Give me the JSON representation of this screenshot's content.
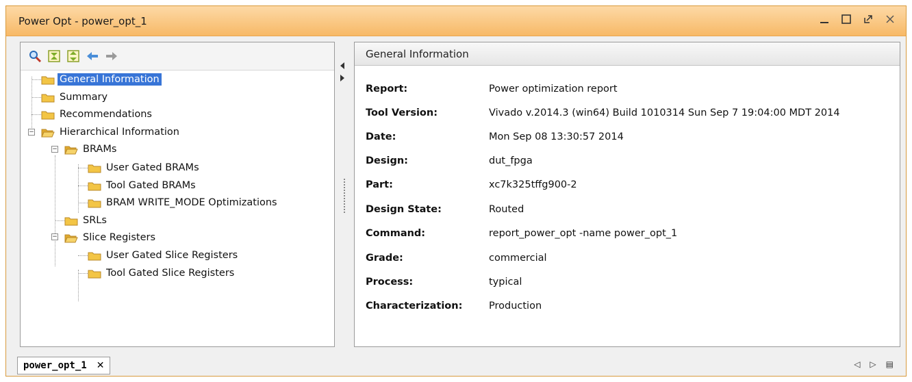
{
  "window": {
    "title": "Power Opt - power_opt_1"
  },
  "tree": {
    "items": [
      {
        "label": "General Information"
      },
      {
        "label": "Summary"
      },
      {
        "label": "Recommendations"
      },
      {
        "label": "Hierarchical Information"
      },
      {
        "label": "BRAMs"
      },
      {
        "label": "User Gated BRAMs"
      },
      {
        "label": "Tool Gated BRAMs"
      },
      {
        "label": "BRAM WRITE_MODE Optimizations"
      },
      {
        "label": "SRLs"
      },
      {
        "label": "Slice Registers"
      },
      {
        "label": "User Gated Slice Registers"
      },
      {
        "label": "Tool Gated Slice Registers"
      }
    ]
  },
  "detail": {
    "header": "General Information",
    "rows": [
      {
        "key": "Report:",
        "value": "Power optimization report"
      },
      {
        "key": "Tool Version:",
        "value": "Vivado v.2014.3 (win64) Build 1010314 Sun Sep 7 19:04:00 MDT 2014"
      },
      {
        "key": "Date:",
        "value": "Mon Sep 08 13:30:57 2014"
      },
      {
        "key": "Design:",
        "value": "dut_fpga"
      },
      {
        "key": "Part:",
        "value": "xc7k325tffg900-2"
      },
      {
        "key": "Design State:",
        "value": "Routed"
      },
      {
        "key": "Command:",
        "value": "report_power_opt -name power_opt_1"
      },
      {
        "key": "Grade:",
        "value": "commercial"
      },
      {
        "key": "Process:",
        "value": "typical"
      },
      {
        "key": "Characterization:",
        "value": "Production"
      }
    ]
  },
  "bottom_tab": {
    "label": "power_opt_1"
  },
  "icons": {
    "toolbar": [
      "search-icon",
      "collapse-all-icon",
      "expand-all-icon",
      "back-arrow-icon",
      "forward-arrow-icon"
    ],
    "window": [
      "minimize-icon",
      "maximize-icon",
      "restore-icon",
      "close-icon"
    ]
  },
  "colors": {
    "titlebar": "#f7b967",
    "selection": "#3875d7",
    "folder": "#f3c545"
  }
}
